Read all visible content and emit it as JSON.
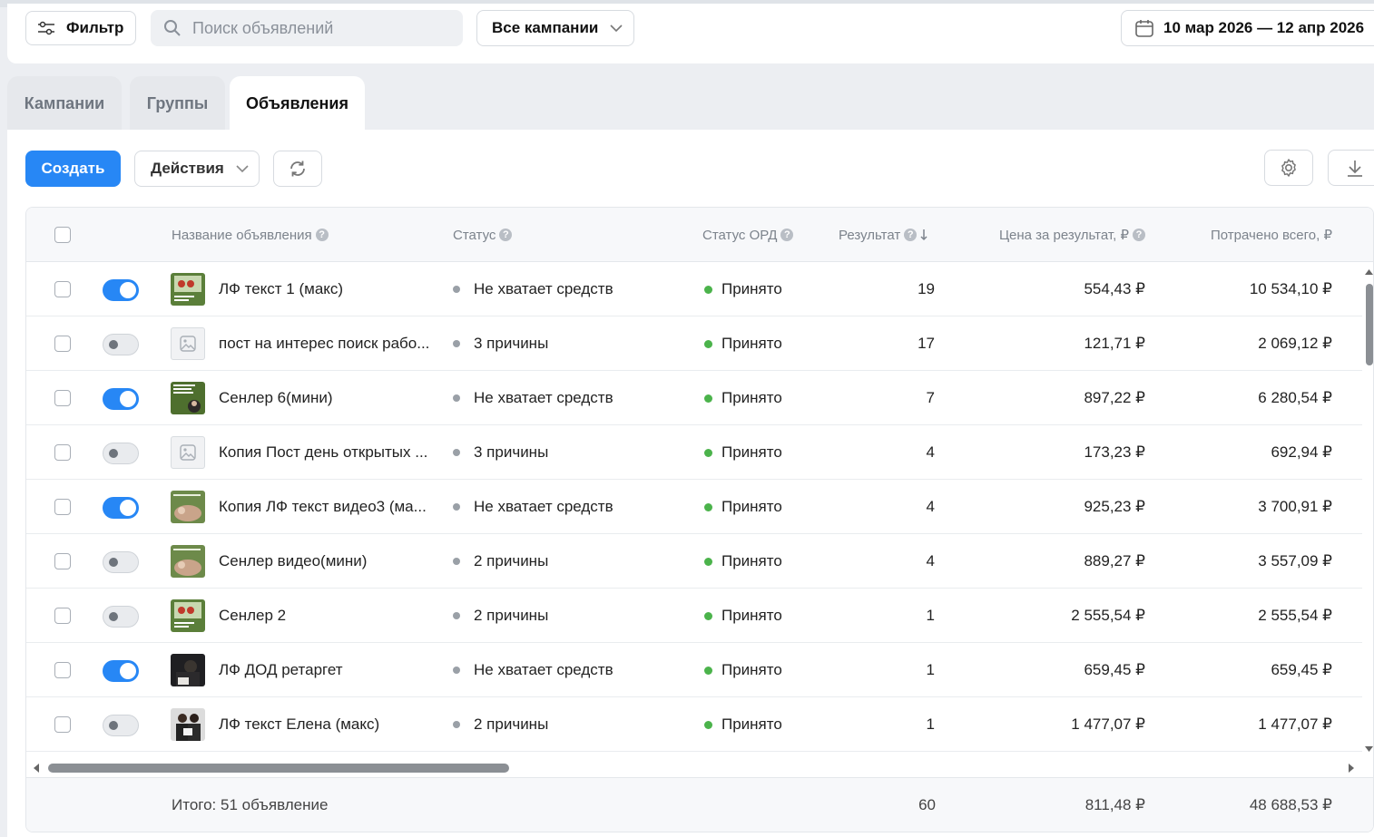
{
  "toolbar": {
    "filter_label": "Фильтр",
    "search_placeholder": "Поиск объявлений",
    "campaign_select": "Все кампании",
    "date_range": "10 мар 2026 — 12 апр 2026"
  },
  "tabs": [
    {
      "label": "Кампании",
      "active": false
    },
    {
      "label": "Группы",
      "active": false
    },
    {
      "label": "Объявления",
      "active": true
    }
  ],
  "actions": {
    "create_label": "Создать",
    "actions_label": "Действия"
  },
  "table": {
    "columns": {
      "name": "Название объявления",
      "status": "Статус",
      "ord_status": "Статус ОРД",
      "result": "Результат",
      "price": "Цена за результат, ₽",
      "spent": "Потрачено всего, ₽"
    },
    "rows": [
      {
        "enabled": true,
        "thumb": "green-promo",
        "name": "ЛФ текст 1 (макс)",
        "status": "Не хватает средств",
        "ord": "Принято",
        "result": "19",
        "price": "554,43 ₽",
        "spent": "10 534,10 ₽"
      },
      {
        "enabled": false,
        "thumb": "placeholder",
        "name": "пост на интерес поиск рабо...",
        "status": "3 причины",
        "ord": "Принято",
        "result": "17",
        "price": "121,71 ₽",
        "spent": "2 069,12 ₽"
      },
      {
        "enabled": true,
        "thumb": "green-text",
        "name": "Сенлер 6(мини)",
        "status": "Не хватает средств",
        "ord": "Принято",
        "result": "7",
        "price": "897,22 ₽",
        "spent": "6 280,54 ₽"
      },
      {
        "enabled": false,
        "thumb": "placeholder",
        "name": "Копия Пост день открытых ...",
        "status": "3 причины",
        "ord": "Принято",
        "result": "4",
        "price": "173,23 ₽",
        "spent": "692,94 ₽"
      },
      {
        "enabled": true,
        "thumb": "green-video",
        "name": "Копия ЛФ текст видео3 (ма...",
        "status": "Не хватает средств",
        "ord": "Принято",
        "result": "4",
        "price": "925,23 ₽",
        "spent": "3 700,91 ₽"
      },
      {
        "enabled": false,
        "thumb": "green-video",
        "name": "Сенлер видео(мини)",
        "status": "2 причины",
        "ord": "Принято",
        "result": "4",
        "price": "889,27 ₽",
        "spent": "3 557,09 ₽"
      },
      {
        "enabled": false,
        "thumb": "green-promo",
        "name": "Сенлер 2",
        "status": "2 причины",
        "ord": "Принято",
        "result": "1",
        "price": "2 555,54 ₽",
        "spent": "2 555,54 ₽"
      },
      {
        "enabled": true,
        "thumb": "dark-photo",
        "name": "ЛФ ДОД ретаргет",
        "status": "Не хватает средств",
        "ord": "Принято",
        "result": "1",
        "price": "659,45 ₽",
        "spent": "659,45 ₽"
      },
      {
        "enabled": false,
        "thumb": "people-photo",
        "name": "ЛФ текст Елена (макс)",
        "status": "2 причины",
        "ord": "Принято",
        "result": "1",
        "price": "1 477,07 ₽",
        "spent": "1 477,07 ₽"
      }
    ],
    "footer": {
      "total_label": "Итого: 51 объявление",
      "result": "60",
      "price": "811,48 ₽",
      "spent": "48 688,53 ₽"
    }
  },
  "colors": {
    "accent": "#2787f5",
    "ord_ok": "#4bb34b",
    "status_dot": "#9aa0a7"
  }
}
